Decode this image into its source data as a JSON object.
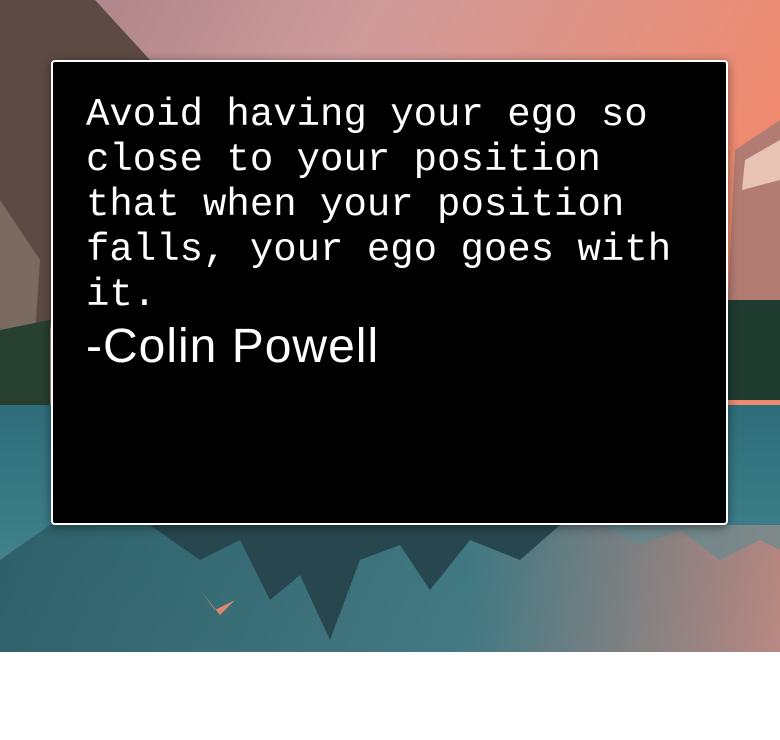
{
  "quote": {
    "text": "Avoid having your ego so close to your position that when your position falls, your ego goes with it.",
    "author": "-Colin Powell"
  },
  "colors": {
    "card_background": "#000000",
    "card_border": "#ffffff",
    "text": "#ffffff",
    "page_background": "#ffffff"
  }
}
